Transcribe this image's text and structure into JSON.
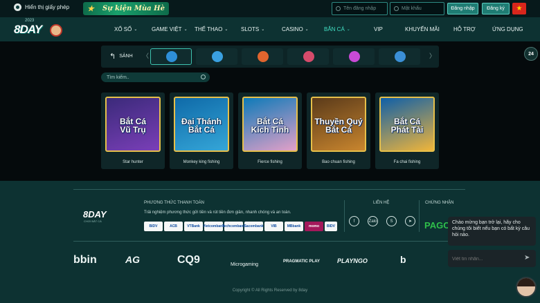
{
  "topbar": {
    "license_label": "Hiển thị giấy phép",
    "event_label": "Sự kiện Mùa Hè",
    "username_placeholder": "Tên đăng nhập",
    "password_placeholder": "Mật khẩu",
    "login_label": "Đăng nhập",
    "register_label": "Đăng ký",
    "flag_icon": "vietnam-flag-icon"
  },
  "brand": {
    "logo_text": "8DAY",
    "logo_year": "2023"
  },
  "nav": {
    "items": [
      {
        "label": "XỔ SỐ",
        "dropdown": true
      },
      {
        "label": "GAME VIỆT",
        "dropdown": true
      },
      {
        "label": "THỂ THAO",
        "dropdown": true
      },
      {
        "label": "SLOTS",
        "dropdown": true
      },
      {
        "label": "CASINO",
        "dropdown": true
      },
      {
        "label": "BẮN CÁ",
        "dropdown": true,
        "active": true
      },
      {
        "label": "VIP",
        "dropdown": false
      },
      {
        "label": "KHUYẾN MÃI",
        "dropdown": false
      },
      {
        "label": "HỖ TRỢ",
        "dropdown": false
      },
      {
        "label": "ỨNG DỤNG",
        "dropdown": false
      }
    ],
    "chevron": "⌄"
  },
  "providers": {
    "back_label": "SẢNH",
    "prev_arrow": "〈",
    "next_arrow": "〉",
    "items": [
      {
        "color": "#2e8fd8",
        "active": true
      },
      {
        "color": "#3aa0e0"
      },
      {
        "color": "#e0652e"
      },
      {
        "color": "#d64b6b"
      },
      {
        "color": "#c94ad6"
      },
      {
        "color": "#3b8fd6"
      }
    ]
  },
  "search": {
    "placeholder": "Tìm kiếm.."
  },
  "games": [
    {
      "title_line1": "Bắt Cá",
      "title_line2": "Vũ Trụ",
      "name": "Star hunter",
      "bg1": "#3b2a7a",
      "bg2": "#7a3fb8"
    },
    {
      "title_line1": "Đại Thánh",
      "title_line2": "Bắt Cá",
      "name": "Monkey king fishing",
      "bg1": "#0f6aa8",
      "bg2": "#35a6d8"
    },
    {
      "title_line1": "Bắt Cá",
      "title_line2": "Kích Tình",
      "name": "Fierce fishing",
      "bg1": "#0d7ab8",
      "bg2": "#e3a0c8"
    },
    {
      "title_line1": "Thuyền Quý",
      "title_line2": "Bắt Cá",
      "name": "Bao chuan fishing",
      "bg1": "#5a3a1a",
      "bg2": "#c9862e"
    },
    {
      "title_line1": "Bắt Cá",
      "title_line2": "Phát Tài",
      "name": "Fa chai fishing",
      "bg1": "#0f5fa8",
      "bg2": "#f0b53a"
    }
  ],
  "footer": {
    "logo_text": "8DAY",
    "logo_tag": "CHƠI BẮT CÁ",
    "payment_heading": "PHƯƠNG THỨC THANH TOÁN",
    "payment_desc": "Trải nghiệm phương thức gửi tiền và rút tiền đơn giản, nhanh chóng và an toàn.",
    "banks": [
      "BIDV",
      "ACB",
      "VTBank",
      "Vietcombank",
      "Techcombank",
      "Sacombank",
      "VIB",
      "MBbank",
      "momo",
      "BIDV"
    ],
    "contact_heading": "LIÊN HỆ",
    "socials": [
      "f",
      "Zalo",
      "S",
      "➤"
    ],
    "cert_heading": "CHỨNG NHẬN",
    "cert_logo": "PAGC",
    "partners": [
      "bbin",
      "AG",
      "CQ9",
      "Microgaming",
      "PRAGMATIC PLAY",
      "PLAYNGO",
      "b"
    ],
    "copyright": "Copyright © All Rights Reserved by 8day"
  },
  "side": {
    "support_label": "24"
  },
  "chat": {
    "message": "Chào mừng bạn trở lại, hãy cho chúng tôi biết nếu bạn có bất kỳ câu hỏi nào.",
    "input_placeholder": "Viết tin nhắn...",
    "send_icon": "➤"
  }
}
